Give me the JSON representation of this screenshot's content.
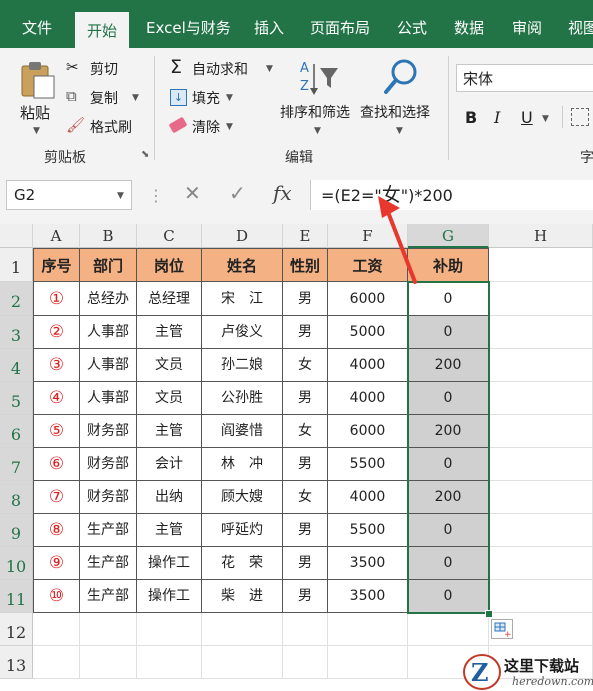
{
  "tabs": [
    {
      "label": "文件",
      "active": false
    },
    {
      "label": "开始",
      "active": true
    },
    {
      "label": "Excel与财务",
      "active": false
    },
    {
      "label": "插入",
      "active": false
    },
    {
      "label": "页面布局",
      "active": false
    },
    {
      "label": "公式",
      "active": false
    },
    {
      "label": "数据",
      "active": false
    },
    {
      "label": "审阅",
      "active": false
    },
    {
      "label": "视图",
      "active": false
    }
  ],
  "ribbon": {
    "clipboard": {
      "paste": "粘贴",
      "cut": "剪切",
      "copy": "复制",
      "format_painter": "格式刷",
      "group": "剪贴板"
    },
    "editing": {
      "autosum": "自动求和",
      "fill": "填充",
      "clear": "清除",
      "sort_filter": "排序和筛选",
      "find_select": "查找和选择",
      "group": "编辑"
    },
    "font": {
      "name": "宋体",
      "bold": "B",
      "italic": "I",
      "underline": "U",
      "group_partial": "字"
    }
  },
  "formula_bar": {
    "name_box": "G2",
    "cancel": "✕",
    "enter": "✓",
    "fx": "fx",
    "formula_pre": "=(E2=\"",
    "formula_mid": "女",
    "formula_post": "\")*200"
  },
  "columns": [
    "A",
    "B",
    "C",
    "D",
    "E",
    "F",
    "G",
    "H"
  ],
  "rows": [
    "1",
    "2",
    "3",
    "4",
    "5",
    "6",
    "7",
    "8",
    "9",
    "10",
    "11",
    "12",
    "13"
  ],
  "table": {
    "headers": [
      "序号",
      "部门",
      "岗位",
      "姓名",
      "性别",
      "工资",
      "补助"
    ],
    "data": [
      [
        "①",
        "总经办",
        "总经理",
        "宋　江",
        "男",
        "6000",
        "0"
      ],
      [
        "②",
        "人事部",
        "主管",
        "卢俊义",
        "男",
        "5000",
        "0"
      ],
      [
        "③",
        "人事部",
        "文员",
        "孙二娘",
        "女",
        "4000",
        "200"
      ],
      [
        "④",
        "人事部",
        "文员",
        "公孙胜",
        "男",
        "4000",
        "0"
      ],
      [
        "⑤",
        "财务部",
        "主管",
        "阎婆惜",
        "女",
        "6000",
        "200"
      ],
      [
        "⑥",
        "财务部",
        "会计",
        "林　冲",
        "男",
        "5500",
        "0"
      ],
      [
        "⑦",
        "财务部",
        "出纳",
        "顾大嫂",
        "女",
        "4000",
        "200"
      ],
      [
        "⑧",
        "生产部",
        "主管",
        "呼延灼",
        "男",
        "5500",
        "0"
      ],
      [
        "⑨",
        "生产部",
        "操作工",
        "花　荣",
        "男",
        "3500",
        "0"
      ],
      [
        "⑩",
        "生产部",
        "操作工",
        "柴　进",
        "男",
        "3500",
        "0"
      ]
    ]
  },
  "watermark": {
    "title": "这里下载站",
    "url": "heredown.com"
  },
  "colors": {
    "excel_green": "#227447",
    "header_fill": "#f4b183",
    "selected_fill": "#d0d0d0",
    "arrow_red": "#e8372c"
  }
}
